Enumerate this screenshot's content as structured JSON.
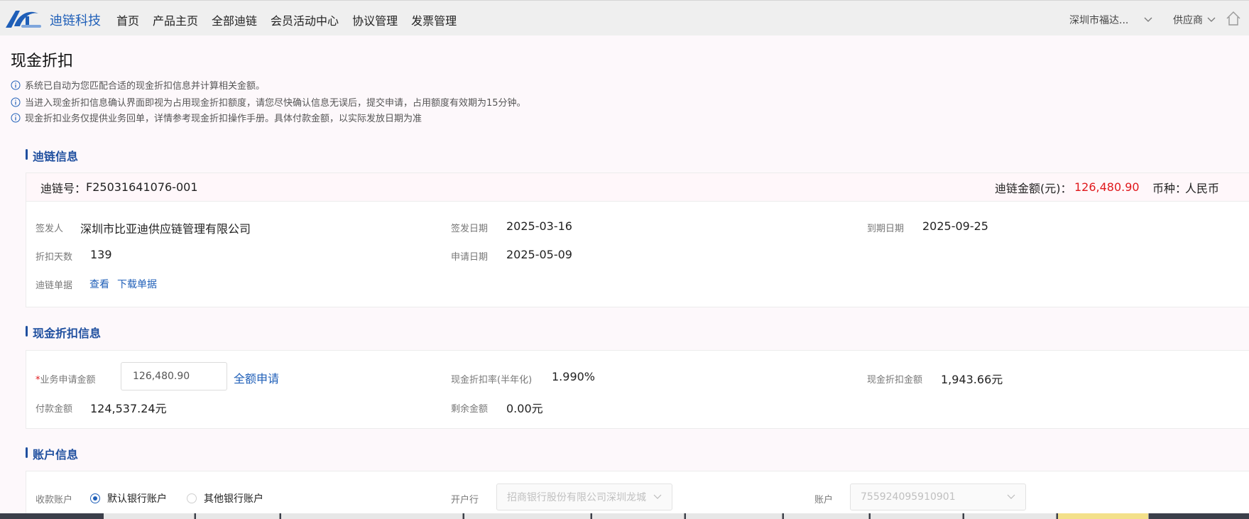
{
  "header": {
    "brand": "迪链科技",
    "nav": [
      "首页",
      "产品主页",
      "全部迪链",
      "会员活动中心",
      "协议管理",
      "发票管理"
    ],
    "company": "深圳市福达...",
    "role": "供应商"
  },
  "page": {
    "title": "现金折扣",
    "notices": [
      "系统已自动为您匹配合适的现金折扣信息并计算相关金额。",
      "当进入现金折扣信息确认界面即视为占用现金折扣额度，请您尽快确认信息无误后，提交申请，占用额度有效期为15分钟。",
      "现金折扣业务仅提供业务回单，详情参考现金折扣操作手册。具体付款金额，以实际发放日期为准"
    ]
  },
  "dilink": {
    "section_title": "迪链信息",
    "number_label": "迪链号：",
    "number": "F25031641076-001",
    "amount_label": "迪链金额(元)：",
    "amount": "126,480.90",
    "currency_label": "币种：",
    "currency": "人民币",
    "issuer_label": "签发人",
    "issuer": "深圳市比亚迪供应链管理有限公司",
    "issue_date_label": "签发日期",
    "issue_date": "2025-03-16",
    "due_date_label": "到期日期",
    "due_date": "2025-09-25",
    "discount_days_label": "折扣天数",
    "discount_days": "139",
    "apply_date_label": "申请日期",
    "apply_date": "2025-05-09",
    "doc_label": "迪链单据",
    "view_link": "查看",
    "download_link": "下载单据"
  },
  "discount": {
    "section_title": "现金折扣信息",
    "apply_amount_label": "业务申请金额",
    "apply_amount_value": "126,480.90",
    "full_apply": "全额申请",
    "rate_label": "现金折扣率(半年化)",
    "rate": "1.990%",
    "discount_amount_label": "现金折扣金额",
    "discount_amount": "1,943.66元",
    "pay_amount_label": "付款金额",
    "pay_amount": "124,537.24元",
    "remaining_label": "剩余金额",
    "remaining": "0.00元"
  },
  "account": {
    "section_title": "账户信息",
    "receive_label": "收款账户",
    "default_option": "默认银行账户",
    "other_option": "其他银行账户",
    "bank_label": "开户行",
    "bank": "招商银行股份有限公司深圳龙城",
    "account_label": "账户",
    "account_number": "755924095910901"
  },
  "colors": {
    "brand": "#1f5fb8",
    "amount_red": "#e0181c",
    "section": "#1f4f9f"
  }
}
